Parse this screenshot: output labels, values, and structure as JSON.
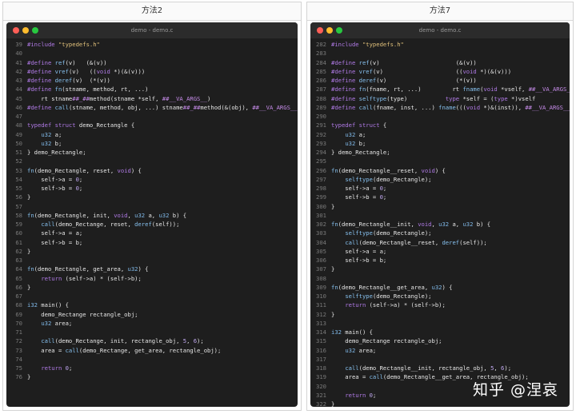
{
  "left": {
    "title": "方法2",
    "filename": "demo - demo.c",
    "lines": [
      {
        "n": "39",
        "t": [
          [
            "kw",
            "#include "
          ],
          [
            "str",
            "\"typedefs.h\""
          ]
        ]
      },
      {
        "n": "40",
        "t": []
      },
      {
        "n": "41",
        "t": [
          [
            "kw",
            "#define "
          ],
          [
            "fn",
            "ref"
          ],
          [
            "pl",
            "(v)   (&(v))"
          ]
        ]
      },
      {
        "n": "42",
        "t": [
          [
            "kw",
            "#define "
          ],
          [
            "fn",
            "vref"
          ],
          [
            "pl",
            "(v)   (("
          ],
          [
            "kw",
            "void "
          ],
          [
            "pl",
            "*)(&(v)))"
          ]
        ]
      },
      {
        "n": "43",
        "t": [
          [
            "kw",
            "#define "
          ],
          [
            "fn",
            "deref"
          ],
          [
            "pl",
            "(v)  (*(v))"
          ]
        ]
      },
      {
        "n": "44",
        "t": [
          [
            "kw",
            "#define "
          ],
          [
            "fn",
            "fn"
          ],
          [
            "pl",
            "(stname, method, rt, ...)                                              \\"
          ]
        ]
      },
      {
        "n": "45",
        "t": [
          [
            "pl",
            "    rt stname"
          ],
          [
            "mac",
            "##_##"
          ],
          [
            "pl",
            "method(stname *self, "
          ],
          [
            "mac",
            "##__VA_ARGS__"
          ],
          [
            "pl",
            ")"
          ]
        ]
      },
      {
        "n": "46",
        "t": [
          [
            "kw",
            "#define "
          ],
          [
            "fn",
            "call"
          ],
          [
            "pl",
            "(stname, method, obj, ...) stname"
          ],
          [
            "mac",
            "##_##"
          ],
          [
            "pl",
            "method(&(obj), "
          ],
          [
            "mac",
            "##__VA_ARGS__"
          ],
          [
            "pl",
            ")"
          ]
        ]
      },
      {
        "n": "47",
        "t": []
      },
      {
        "n": "48",
        "t": [
          [
            "kw",
            "typedef struct "
          ],
          [
            "pl",
            "demo_Rectangle {"
          ]
        ]
      },
      {
        "n": "49",
        "t": [
          [
            "pl",
            "    "
          ],
          [
            "ty",
            "u32"
          ],
          [
            "pl",
            " a;"
          ]
        ]
      },
      {
        "n": "50",
        "t": [
          [
            "pl",
            "    "
          ],
          [
            "ty",
            "u32"
          ],
          [
            "pl",
            " b;"
          ]
        ]
      },
      {
        "n": "51",
        "t": [
          [
            "pl",
            "} demo_Rectangle;"
          ]
        ]
      },
      {
        "n": "52",
        "t": []
      },
      {
        "n": "53",
        "t": [
          [
            "fn",
            "fn"
          ],
          [
            "pl",
            "(demo_Rectangle, reset, "
          ],
          [
            "kw",
            "void"
          ],
          [
            "pl",
            ") {"
          ]
        ]
      },
      {
        "n": "54",
        "t": [
          [
            "pl",
            "    self->a = "
          ],
          [
            "num",
            "0"
          ],
          [
            "pl",
            ";"
          ]
        ]
      },
      {
        "n": "55",
        "t": [
          [
            "pl",
            "    self->b = "
          ],
          [
            "num",
            "0"
          ],
          [
            "pl",
            ";"
          ]
        ]
      },
      {
        "n": "56",
        "t": [
          [
            "pl",
            "}"
          ]
        ]
      },
      {
        "n": "57",
        "t": []
      },
      {
        "n": "58",
        "t": [
          [
            "fn",
            "fn"
          ],
          [
            "pl",
            "(demo_Rectangle, init, "
          ],
          [
            "kw",
            "void"
          ],
          [
            "pl",
            ", "
          ],
          [
            "ty",
            "u32"
          ],
          [
            "pl",
            " a, "
          ],
          [
            "ty",
            "u32"
          ],
          [
            "pl",
            " b) {"
          ]
        ]
      },
      {
        "n": "59",
        "t": [
          [
            "pl",
            "    "
          ],
          [
            "fn",
            "call"
          ],
          [
            "pl",
            "(demo_Rectange, reset, "
          ],
          [
            "fn",
            "deref"
          ],
          [
            "pl",
            "(self));"
          ]
        ]
      },
      {
        "n": "60",
        "t": [
          [
            "pl",
            "    self->a = a;"
          ]
        ]
      },
      {
        "n": "61",
        "t": [
          [
            "pl",
            "    self->b = b;"
          ]
        ]
      },
      {
        "n": "62",
        "t": [
          [
            "pl",
            "}"
          ]
        ]
      },
      {
        "n": "63",
        "t": []
      },
      {
        "n": "64",
        "t": [
          [
            "fn",
            "fn"
          ],
          [
            "pl",
            "(demo_Rectangle, get_area, "
          ],
          [
            "ty",
            "u32"
          ],
          [
            "pl",
            ") {"
          ]
        ]
      },
      {
        "n": "65",
        "t": [
          [
            "pl",
            "    "
          ],
          [
            "kw",
            "return"
          ],
          [
            "pl",
            " (self->a) * (self->b);"
          ]
        ]
      },
      {
        "n": "66",
        "t": [
          [
            "pl",
            "}"
          ]
        ]
      },
      {
        "n": "67",
        "t": []
      },
      {
        "n": "68",
        "t": [
          [
            "ty",
            "i32"
          ],
          [
            "pl",
            " main() {"
          ]
        ]
      },
      {
        "n": "69",
        "t": [
          [
            "pl",
            "    demo_Rectange rectangle_obj;"
          ]
        ]
      },
      {
        "n": "70",
        "t": [
          [
            "pl",
            "    "
          ],
          [
            "ty",
            "u32"
          ],
          [
            "pl",
            " area;"
          ]
        ]
      },
      {
        "n": "71",
        "t": []
      },
      {
        "n": "72",
        "t": [
          [
            "pl",
            "    "
          ],
          [
            "fn",
            "call"
          ],
          [
            "pl",
            "(demo_Rectange, init, rectangle_obj, "
          ],
          [
            "num",
            "5"
          ],
          [
            "pl",
            ", "
          ],
          [
            "num",
            "6"
          ],
          [
            "pl",
            ");"
          ]
        ]
      },
      {
        "n": "73",
        "t": [
          [
            "pl",
            "    area = "
          ],
          [
            "fn",
            "call"
          ],
          [
            "pl",
            "(demo_Rectange, get_area, rectangle_obj);"
          ]
        ]
      },
      {
        "n": "74",
        "t": []
      },
      {
        "n": "75",
        "t": [
          [
            "pl",
            "    "
          ],
          [
            "kw",
            "return"
          ],
          [
            "pl",
            " "
          ],
          [
            "num",
            "0"
          ],
          [
            "pl",
            ";"
          ]
        ]
      },
      {
        "n": "76",
        "t": [
          [
            "pl",
            "}"
          ]
        ]
      }
    ]
  },
  "right": {
    "title": "方法7",
    "filename": "demo - demo.c",
    "lines": [
      {
        "n": "282",
        "t": [
          [
            "kw",
            "#include "
          ],
          [
            "str",
            "\"typedefs.h\""
          ]
        ]
      },
      {
        "n": "283",
        "t": []
      },
      {
        "n": "284",
        "t": [
          [
            "kw",
            "#define "
          ],
          [
            "fn",
            "ref"
          ],
          [
            "pl",
            "(v)                      (&(v))"
          ]
        ]
      },
      {
        "n": "285",
        "t": [
          [
            "kw",
            "#define "
          ],
          [
            "fn",
            "vref"
          ],
          [
            "pl",
            "(v)                     (("
          ],
          [
            "kw",
            "void"
          ],
          [
            "pl",
            " *)(&(v)))"
          ]
        ]
      },
      {
        "n": "286",
        "t": [
          [
            "kw",
            "#define "
          ],
          [
            "fn",
            "deref"
          ],
          [
            "pl",
            "(v)                    (*(v))"
          ]
        ]
      },
      {
        "n": "287",
        "t": [
          [
            "kw",
            "#define "
          ],
          [
            "fn",
            "fn"
          ],
          [
            "pl",
            "(fname, rt, ...)         rt "
          ],
          [
            "fn",
            "fname"
          ],
          [
            "pl",
            "("
          ],
          [
            "kw",
            "void"
          ],
          [
            "pl",
            " *vself, "
          ],
          [
            "mac",
            "##__VA_ARGS__"
          ],
          [
            "pl",
            ")"
          ]
        ]
      },
      {
        "n": "288",
        "t": [
          [
            "kw",
            "#define "
          ],
          [
            "fn",
            "selftype"
          ],
          [
            "pl",
            "(type)           "
          ],
          [
            "kw",
            "type"
          ],
          [
            "pl",
            " *self = ("
          ],
          [
            "kw",
            "type"
          ],
          [
            "pl",
            " *)vself"
          ]
        ]
      },
      {
        "n": "289",
        "t": [
          [
            "kw",
            "#define "
          ],
          [
            "fn",
            "call"
          ],
          [
            "pl",
            "(fname, inst, ...) "
          ],
          [
            "fn",
            "fname"
          ],
          [
            "pl",
            "((("
          ],
          [
            "kw",
            "void"
          ],
          [
            "pl",
            " *)&(inst)), "
          ],
          [
            "mac",
            "##__VA_ARGS__"
          ],
          [
            "pl",
            ")"
          ]
        ]
      },
      {
        "n": "290",
        "t": []
      },
      {
        "n": "291",
        "t": [
          [
            "kw",
            "typedef struct"
          ],
          [
            "pl",
            " {"
          ]
        ]
      },
      {
        "n": "292",
        "t": [
          [
            "pl",
            "    "
          ],
          [
            "ty",
            "u32"
          ],
          [
            "pl",
            " a;"
          ]
        ]
      },
      {
        "n": "293",
        "t": [
          [
            "pl",
            "    "
          ],
          [
            "ty",
            "u32"
          ],
          [
            "pl",
            " b;"
          ]
        ]
      },
      {
        "n": "294",
        "t": [
          [
            "pl",
            "} demo_Rectangle;"
          ]
        ]
      },
      {
        "n": "295",
        "t": []
      },
      {
        "n": "296",
        "t": [
          [
            "fn",
            "fn"
          ],
          [
            "pl",
            "(demo_Rectangle__reset, "
          ],
          [
            "kw",
            "void"
          ],
          [
            "pl",
            ") {"
          ]
        ]
      },
      {
        "n": "297",
        "t": [
          [
            "pl",
            "    "
          ],
          [
            "fn",
            "selftype"
          ],
          [
            "pl",
            "(demo_Rectangle);"
          ]
        ]
      },
      {
        "n": "298",
        "t": [
          [
            "pl",
            "    self->a = "
          ],
          [
            "num",
            "0"
          ],
          [
            "pl",
            ";"
          ]
        ]
      },
      {
        "n": "299",
        "t": [
          [
            "pl",
            "    self->b = "
          ],
          [
            "num",
            "0"
          ],
          [
            "pl",
            ";"
          ]
        ]
      },
      {
        "n": "300",
        "t": [
          [
            "pl",
            "}"
          ]
        ]
      },
      {
        "n": "301",
        "t": []
      },
      {
        "n": "302",
        "t": [
          [
            "fn",
            "fn"
          ],
          [
            "pl",
            "(demo_Rectangle__init, "
          ],
          [
            "kw",
            "void"
          ],
          [
            "pl",
            ", "
          ],
          [
            "ty",
            "u32"
          ],
          [
            "pl",
            " a, "
          ],
          [
            "ty",
            "u32"
          ],
          [
            "pl",
            " b) {"
          ]
        ]
      },
      {
        "n": "303",
        "t": [
          [
            "pl",
            "    "
          ],
          [
            "fn",
            "selftype"
          ],
          [
            "pl",
            "(demo_Rectangle);"
          ]
        ]
      },
      {
        "n": "304",
        "t": [
          [
            "pl",
            "    "
          ],
          [
            "fn",
            "call"
          ],
          [
            "pl",
            "(demo_Rectangle__reset, "
          ],
          [
            "fn",
            "deref"
          ],
          [
            "pl",
            "(self));"
          ]
        ]
      },
      {
        "n": "305",
        "t": [
          [
            "pl",
            "    self->a = a;"
          ]
        ]
      },
      {
        "n": "306",
        "t": [
          [
            "pl",
            "    self->b = b;"
          ]
        ]
      },
      {
        "n": "307",
        "t": [
          [
            "pl",
            "}"
          ]
        ]
      },
      {
        "n": "308",
        "t": []
      },
      {
        "n": "309",
        "t": [
          [
            "fn",
            "fn"
          ],
          [
            "pl",
            "(demo_Rectangle__get_area, "
          ],
          [
            "ty",
            "u32"
          ],
          [
            "pl",
            ") {"
          ]
        ]
      },
      {
        "n": "310",
        "t": [
          [
            "pl",
            "    "
          ],
          [
            "fn",
            "selftype"
          ],
          [
            "pl",
            "(demo_Rectangle);"
          ]
        ]
      },
      {
        "n": "311",
        "t": [
          [
            "pl",
            "    "
          ],
          [
            "kw",
            "return"
          ],
          [
            "pl",
            " (self->a) * (self->b);"
          ]
        ]
      },
      {
        "n": "312",
        "t": [
          [
            "pl",
            "}"
          ]
        ]
      },
      {
        "n": "313",
        "t": []
      },
      {
        "n": "314",
        "t": [
          [
            "ty",
            "i32"
          ],
          [
            "pl",
            " main() {"
          ]
        ]
      },
      {
        "n": "315",
        "t": [
          [
            "pl",
            "    demo_Rectange rectangle_obj;"
          ]
        ]
      },
      {
        "n": "316",
        "t": [
          [
            "pl",
            "    "
          ],
          [
            "ty",
            "u32"
          ],
          [
            "pl",
            " area;"
          ]
        ]
      },
      {
        "n": "317",
        "t": []
      },
      {
        "n": "318",
        "t": [
          [
            "pl",
            "    "
          ],
          [
            "fn",
            "call"
          ],
          [
            "pl",
            "(demo_Rectangle__init, rectangle_obj, "
          ],
          [
            "num",
            "5"
          ],
          [
            "pl",
            ", "
          ],
          [
            "num",
            "6"
          ],
          [
            "pl",
            ");"
          ]
        ]
      },
      {
        "n": "319",
        "t": [
          [
            "pl",
            "    area = "
          ],
          [
            "fn",
            "call"
          ],
          [
            "pl",
            "(demo_Rectangle__get_area, rectangle_obj);"
          ]
        ]
      },
      {
        "n": "320",
        "t": []
      },
      {
        "n": "321",
        "t": [
          [
            "pl",
            "    "
          ],
          [
            "kw",
            "return"
          ],
          [
            "pl",
            " "
          ],
          [
            "num",
            "0"
          ],
          [
            "pl",
            ";"
          ]
        ]
      },
      {
        "n": "322",
        "t": [
          [
            "pl",
            "}"
          ]
        ]
      }
    ]
  },
  "watermark": "知乎 @涅哀"
}
